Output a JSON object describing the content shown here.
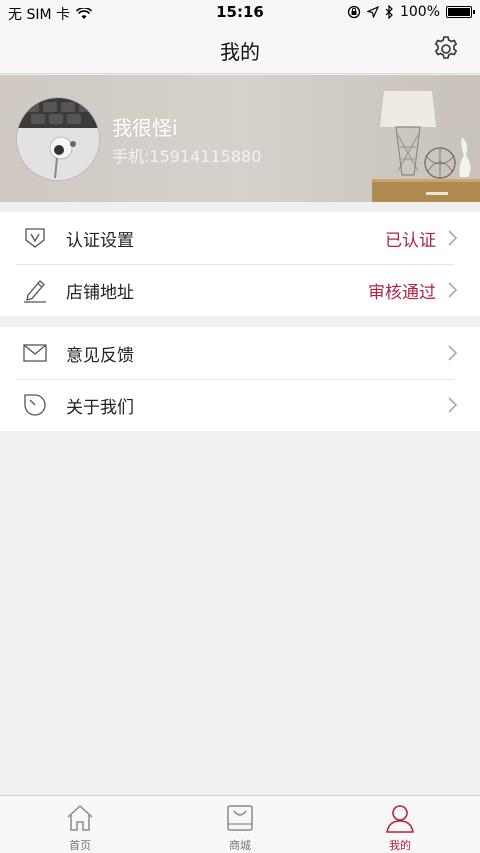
{
  "status_bar": {
    "carrier": "无 SIM 卡",
    "time": "15:16",
    "battery": "100%",
    "battery_level": 1.0
  },
  "nav": {
    "title": "我的",
    "settings_icon": "gear-icon"
  },
  "profile": {
    "name": "我很怪i",
    "phone": "手机:15914115880"
  },
  "group1": [
    {
      "label": "认证设置",
      "value": "已认证",
      "icon": "shield-v-icon"
    },
    {
      "label": "店铺地址",
      "value": "审核通过",
      "icon": "pencil-icon"
    }
  ],
  "group2": [
    {
      "label": "意见反馈",
      "value": "",
      "icon": "envelope-icon"
    },
    {
      "label": "关于我们",
      "value": "",
      "icon": "info-tag-icon"
    }
  ],
  "tabs": [
    {
      "label": "首页",
      "icon": "home-icon",
      "active": false
    },
    {
      "label": "商城",
      "icon": "shopping-bag-icon",
      "active": false
    },
    {
      "label": "我的",
      "icon": "person-icon",
      "active": true
    }
  ],
  "colors": {
    "accent": "#b3243f",
    "background": "#f0f0f0"
  }
}
